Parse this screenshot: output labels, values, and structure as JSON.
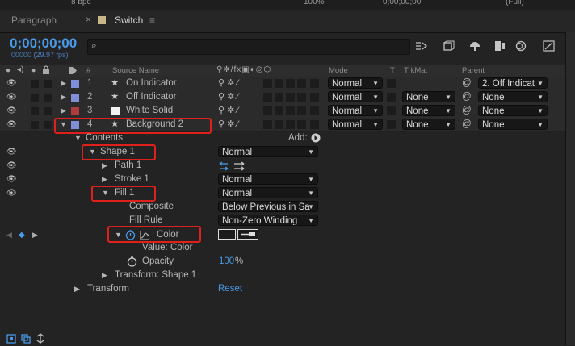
{
  "top": {
    "bpc": "8 bpc",
    "zoom": "100%",
    "time": "0;00;00;00",
    "view": "(Full)"
  },
  "tabs": [
    {
      "label": "Paragraph"
    },
    {
      "label": "Switch",
      "close": "×",
      "menu": "≡"
    }
  ],
  "time": {
    "timecode": "0;00;00;00",
    "fps": "00000 (29.97 fps)"
  },
  "search": {
    "placeholder": "",
    "glyph": "⌕"
  },
  "columns": {
    "hash": "#",
    "source_name": "Source Name",
    "mode": "Mode",
    "t": "T",
    "trkmat": "TrkMat",
    "parent": "Parent"
  },
  "layers": [
    {
      "num": "1",
      "name": "On Indicator",
      "color": "#7e8fd8",
      "mode": "Normal",
      "trkmat": "",
      "parent": "2. Off Indicat"
    },
    {
      "num": "2",
      "name": "Off Indicator",
      "color": "#7e8fd8",
      "mode": "Normal",
      "trkmat": "None",
      "parent": "None"
    },
    {
      "num": "3",
      "name": "White Solid",
      "color": "#b13c3c",
      "mode": "Normal",
      "trkmat": "None",
      "parent": "None"
    },
    {
      "num": "4",
      "name": "Background 2",
      "color": "#7e8fd8",
      "mode": "Normal",
      "trkmat": "None",
      "parent": "None"
    }
  ],
  "tree": {
    "contents": "Contents",
    "add_label": "Add:",
    "shape1": {
      "name": "Shape 1",
      "mode": "Normal"
    },
    "path1": "Path 1",
    "stroke1": {
      "name": "Stroke 1",
      "mode": "Normal"
    },
    "fill1": {
      "name": "Fill 1",
      "mode": "Normal"
    },
    "composite": {
      "label": "Composite",
      "value": "Below Previous in Sa"
    },
    "fill_rule": {
      "label": "Fill Rule",
      "value": "Non-Zero Winding"
    },
    "color": {
      "label": "Color"
    },
    "value_color": "Value: Color",
    "opacity": {
      "label": "Opacity",
      "value": "100",
      "unit": "%"
    },
    "transform_shape": "Transform: Shape 1",
    "transform": {
      "label": "Transform",
      "reset": "Reset"
    }
  },
  "colors": {
    "accent": "#4a9ae8",
    "highlight": "#e0211b"
  }
}
